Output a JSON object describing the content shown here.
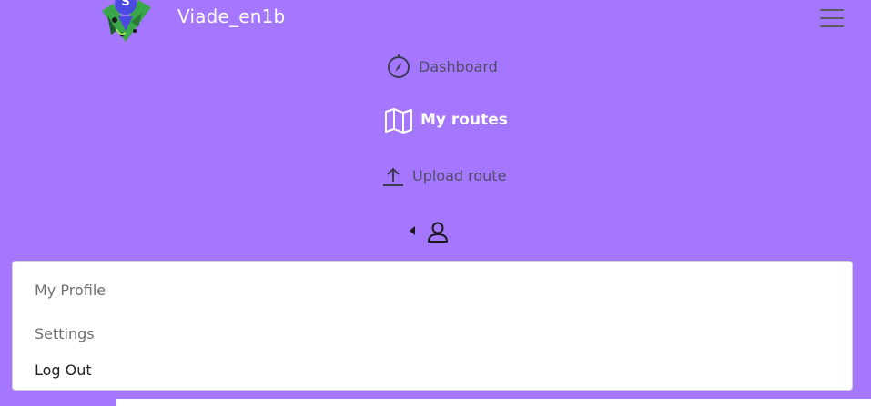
{
  "brand": {
    "name": "Viade_en1b",
    "logo_icon": "viade-map-pin-logo-icon"
  },
  "navbar": {
    "toggle_icon": "hamburger-menu-icon",
    "items": [
      {
        "label": "Dashboard",
        "icon": "compass-icon",
        "active": false
      },
      {
        "label": "My routes",
        "icon": "map-icon",
        "active": true
      },
      {
        "label": "Upload route",
        "icon": "upload-icon",
        "active": false
      }
    ],
    "user_toggle_icon": "person-icon"
  },
  "user_menu": {
    "items": [
      {
        "label": "My Profile"
      },
      {
        "label": "Settings"
      },
      {
        "label": "Log Out"
      }
    ]
  },
  "colors": {
    "navbar_bg": "#a576fe",
    "link": "#4d4d6a",
    "active_link": "#ffffff",
    "menu_bg": "#ffffff"
  }
}
